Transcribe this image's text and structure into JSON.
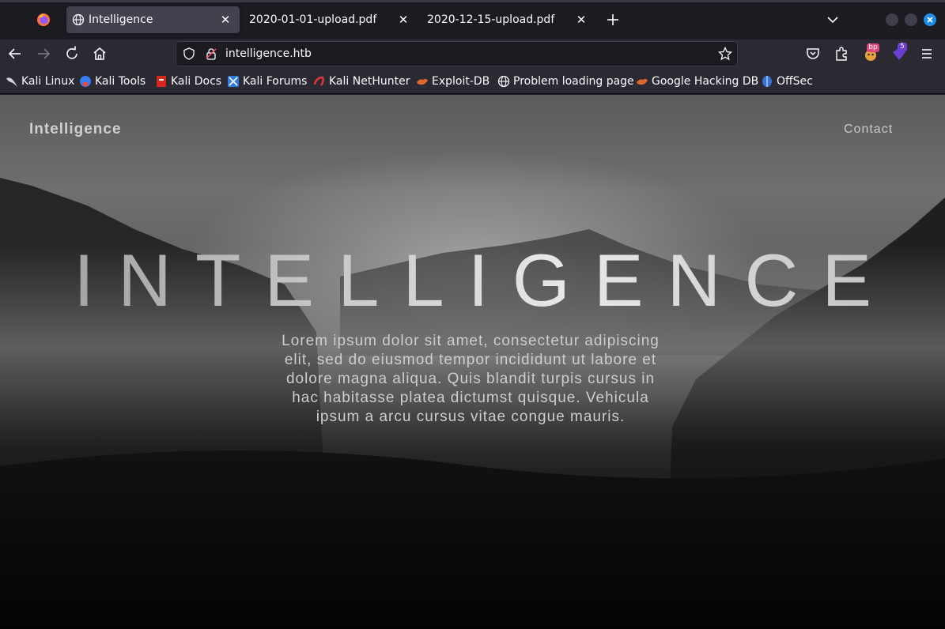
{
  "tabs": [
    {
      "title": "Intelligence",
      "active": true
    },
    {
      "title": "2020-01-01-upload.pdf",
      "active": false
    },
    {
      "title": "2020-12-15-upload.pdf",
      "active": false
    }
  ],
  "address_bar": {
    "url": "intelligence.htb"
  },
  "extensions": {
    "burp_badge": "bp",
    "counter_badge": "5"
  },
  "bookmarks": [
    {
      "label": "Kali Linux",
      "icon": "kali-dragon-icon"
    },
    {
      "label": "Kali Tools",
      "icon": "kali-tools-icon"
    },
    {
      "label": "Kali Docs",
      "icon": "kali-docs-icon"
    },
    {
      "label": "Kali Forums",
      "icon": "kali-forums-icon"
    },
    {
      "label": "Kali NetHunter",
      "icon": "nethunter-icon"
    },
    {
      "label": "Exploit-DB",
      "icon": "exploit-db-icon"
    },
    {
      "label": "Problem loading page",
      "icon": "globe-icon"
    },
    {
      "label": "Google Hacking DB",
      "icon": "ghdb-icon"
    },
    {
      "label": "OffSec",
      "icon": "offsec-icon"
    }
  ],
  "page": {
    "brand": "Intelligence",
    "nav_contact": "Contact",
    "hero_title": "INTELLIGENCE",
    "lead_text": "Lorem ipsum dolor sit amet, consectetur adipiscing elit, sed do eiusmod tempor incididunt ut labore et dolore magna aliqua. Quis blandit turpis cursus in hac habitasse platea dictumst quisque. Vehicula ipsum a arcu cursus vitae congue mauris."
  },
  "colors": {
    "browser_bg": "#1c1b22",
    "toolbar_bg": "#2b2a33",
    "tab_active": "#42414d",
    "close_accent": "#1d8fe8"
  }
}
